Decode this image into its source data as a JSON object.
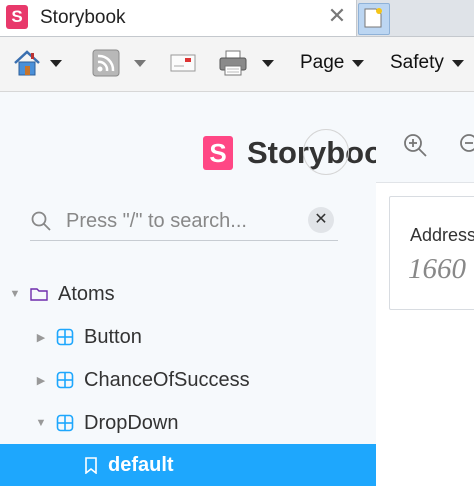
{
  "browser": {
    "tab_title": "Storybook",
    "tab_favicon_letter": "S",
    "tab_close": "✕"
  },
  "commandbar": {
    "page_label": "Page",
    "safety_label": "Safety"
  },
  "sidebar": {
    "brand_letter": "S",
    "brand_name": "Storybook",
    "search_placeholder": "Press \"/\" to search...",
    "search_clear": "✕",
    "tree": [
      {
        "label": "Atoms",
        "kind": "folder",
        "expanded": true
      },
      {
        "label": "Button",
        "kind": "component",
        "expanded": false
      },
      {
        "label": "ChanceOfSuccess",
        "kind": "component",
        "expanded": false
      },
      {
        "label": "DropDown",
        "kind": "component",
        "expanded": true
      },
      {
        "label": "default",
        "kind": "story",
        "selected": true
      }
    ]
  },
  "preview": {
    "card_label": "Address",
    "card_value": "1660"
  },
  "colors": {
    "accent": "#1ea7fd",
    "brand_pink": "#ff4785",
    "sidebar_bg": "#f6f9fc"
  }
}
